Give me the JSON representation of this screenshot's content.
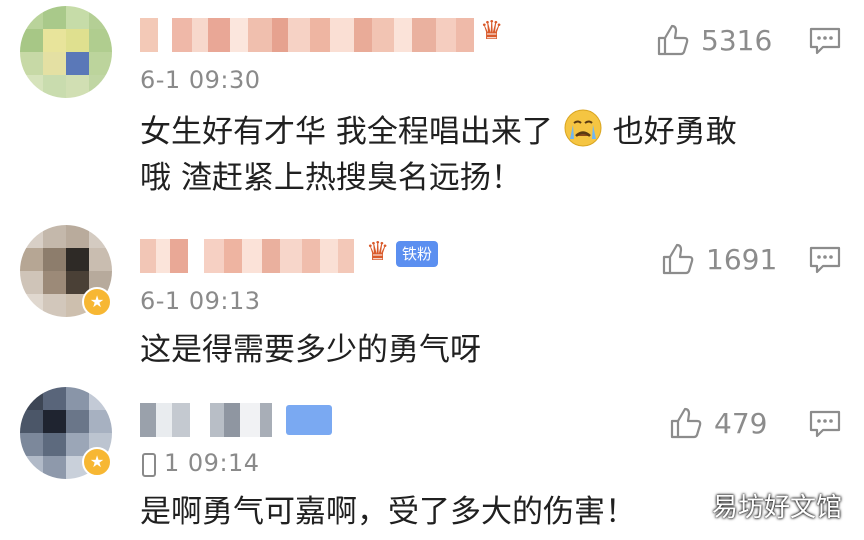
{
  "comments": [
    {
      "time": "6-1 09:30",
      "text_line1": "女生好有才华 我全程唱出来了",
      "text_line1b": "也好勇敢",
      "text_line2": "哦 渣赶紧上热搜臭名远扬！",
      "likes": "5316",
      "emoji": "crying-face-icon"
    },
    {
      "time": "6-1 09:13",
      "text": "这是得需要多少的勇气呀",
      "likes": "1691",
      "fan_badge": "铁粉"
    },
    {
      "time": "1 09:14",
      "text": "是啊勇气可嘉啊，受了多大的伤害！",
      "likes": "479"
    }
  ],
  "watermark": "易坊好文馆",
  "colors": {
    "accent_blue": "#5b8ff0",
    "crown": "#d95a2b",
    "meta_gray": "#8a8a8a"
  }
}
